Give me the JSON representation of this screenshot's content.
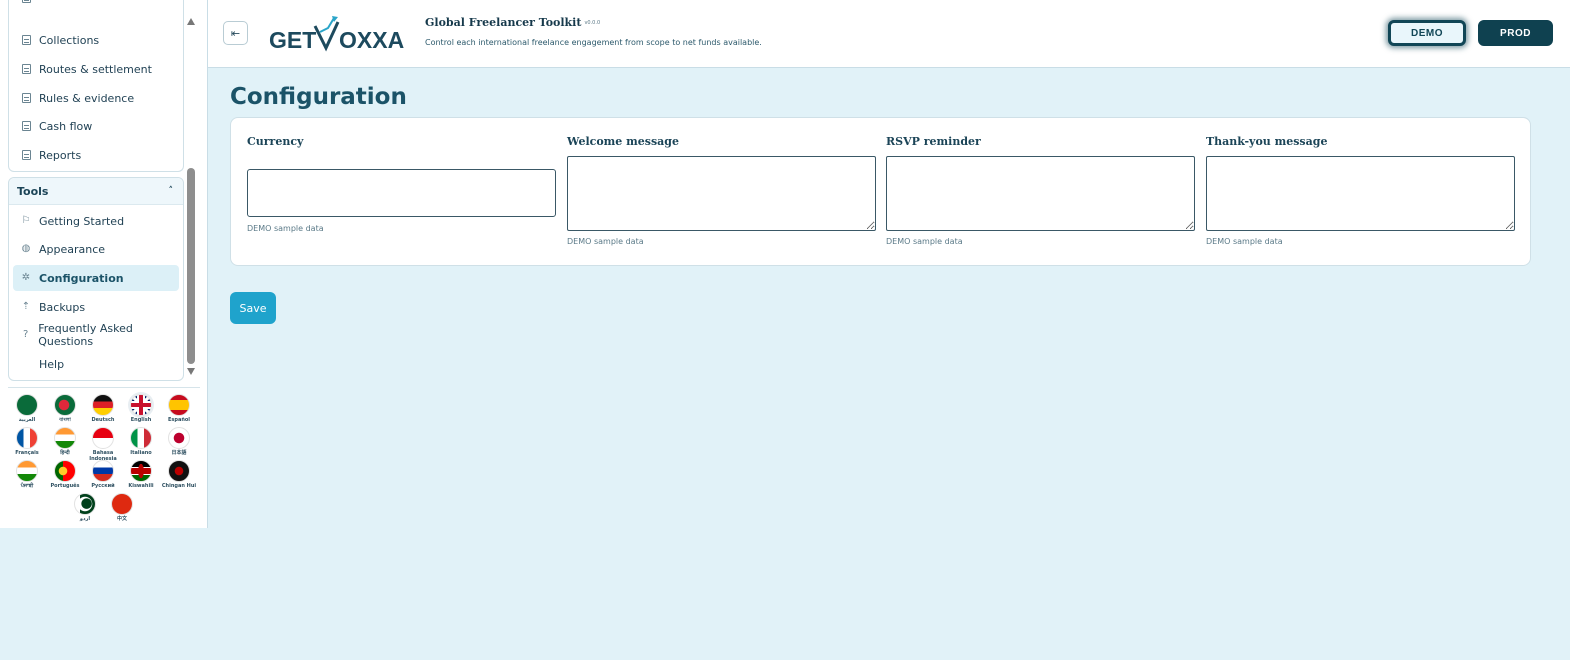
{
  "sidebar": {
    "top_items": [
      {
        "label": "Collections",
        "icon": "document-icon"
      },
      {
        "label": "Routes & settlement",
        "icon": "document-icon"
      },
      {
        "label": "Rules & evidence",
        "icon": "document-icon"
      },
      {
        "label": "Cash flow",
        "icon": "document-icon"
      },
      {
        "label": "Reports",
        "icon": "document-icon"
      }
    ],
    "tools_section": {
      "title": "Tools",
      "items": [
        {
          "label": "Getting Started",
          "icon": "flag-icon"
        },
        {
          "label": "Appearance",
          "icon": "palette-icon"
        },
        {
          "label": "Configuration",
          "icon": "gear-icon",
          "active": true
        },
        {
          "label": "Backups",
          "icon": "upload-icon"
        },
        {
          "label": "Frequently Asked Questions",
          "icon": "question-icon"
        },
        {
          "label": "Help",
          "icon": ""
        }
      ]
    },
    "languages": [
      {
        "label": "العربية"
      },
      {
        "label": "বাংলা"
      },
      {
        "label": "Deutsch"
      },
      {
        "label": "English",
        "selected": true
      },
      {
        "label": "Español"
      },
      {
        "label": "Français"
      },
      {
        "label": "हिन्दी"
      },
      {
        "label": "Bahasa Indonesia"
      },
      {
        "label": "Italiano"
      },
      {
        "label": "日本語"
      },
      {
        "label": "ਪੰਜਾਬੀ"
      },
      {
        "label": "Português"
      },
      {
        "label": "Русский"
      },
      {
        "label": "Kiswahili"
      },
      {
        "label": "Chingan Hui"
      },
      {
        "label": "اردو"
      },
      {
        "label": "中文"
      }
    ]
  },
  "header": {
    "logo_text": "GETVOXXA",
    "app_title": "Global Freelancer Toolkit",
    "version": "v0.0.0",
    "subtitle": "Control each international freelance engagement from scope to net funds available.",
    "env_demo": "DEMO",
    "env_prod": "PROD",
    "colors": {
      "primary": "#1b5368",
      "accent": "#1fa3cc",
      "dark": "#0f4150"
    }
  },
  "main": {
    "title": "Configuration",
    "fields": [
      {
        "label": "Currency",
        "value": "",
        "help": "DEMO sample data",
        "type": "input"
      },
      {
        "label": "Welcome message",
        "value": "",
        "help": "DEMO sample data",
        "type": "textarea"
      },
      {
        "label": "RSVP reminder",
        "value": "",
        "help": "DEMO sample data",
        "type": "textarea"
      },
      {
        "label": "Thank-you message",
        "value": "",
        "help": "DEMO sample data",
        "type": "textarea"
      }
    ],
    "save_label": "Save"
  }
}
